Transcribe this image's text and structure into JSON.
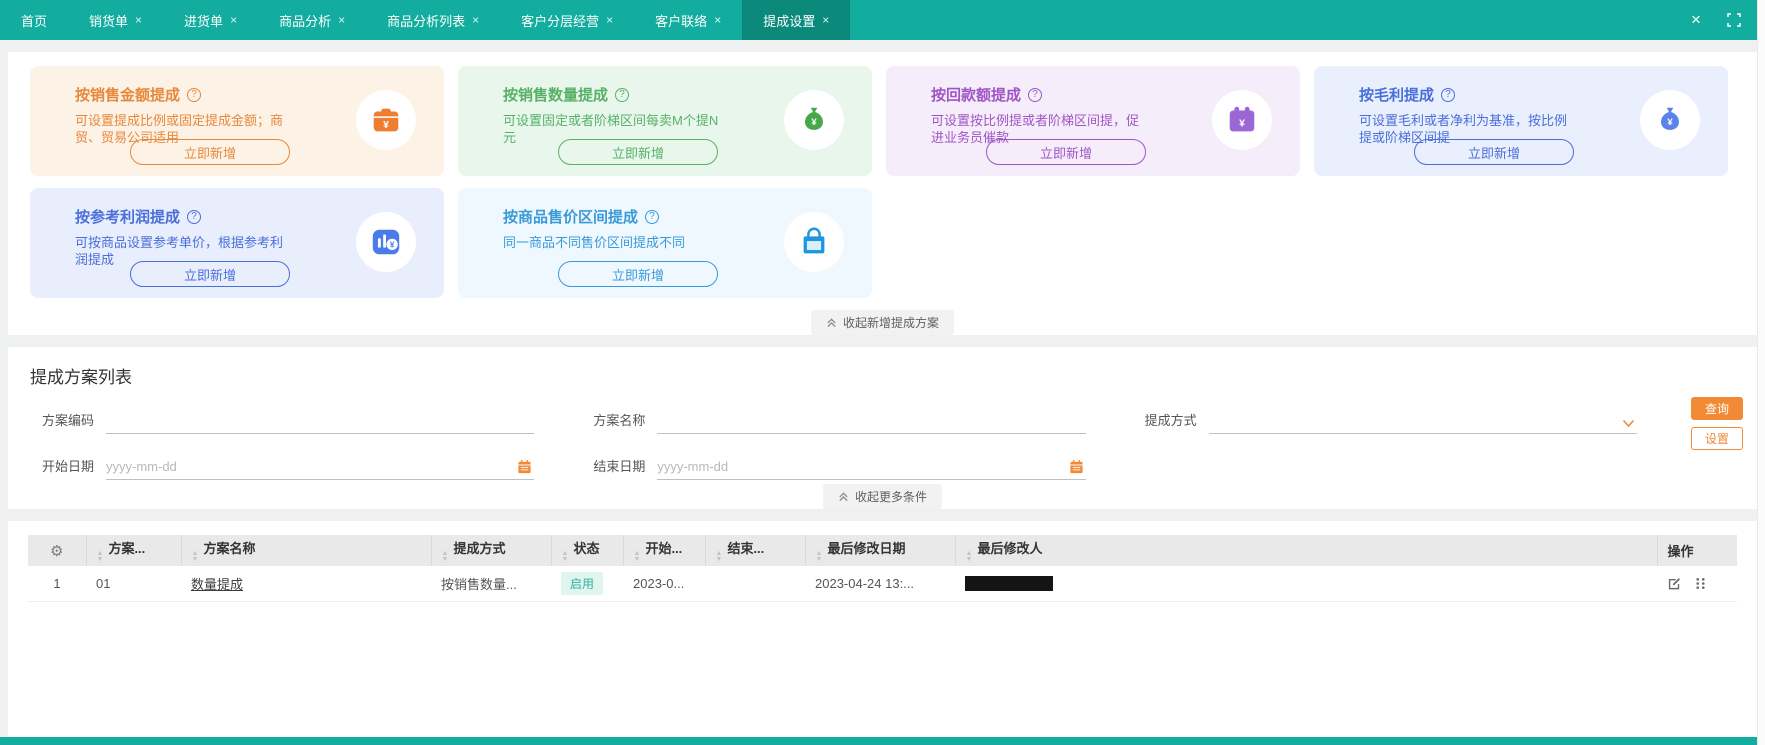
{
  "colors": {
    "teal": "#12ad9e",
    "teal_dark": "#0b8a7c",
    "orange": "#f28935",
    "card_orange_bg": "#fdf2e6",
    "card_orange_fg": "#e8883c",
    "card_orange_icon": "#ed7d2f",
    "card_green_bg": "#e8f6ec",
    "card_green_fg": "#58b167",
    "card_green_icon": "#46a84b",
    "card_purple_bg": "#f5eefa",
    "card_purple_fg": "#a055c6",
    "card_purple_icon": "#9a67d5",
    "card_blue_bg": "#e9effc",
    "card_blue_fg": "#4a6fdc",
    "card_blue_icon": "#5b82ea",
    "card_indigo_bg": "#e9eefc",
    "card_indigo_fg": "#4a6fdc",
    "card_indigo_icon": "#4a7be8",
    "card_cyan_bg": "#eef8fe",
    "card_cyan_fg": "#3b9ad8",
    "card_cyan_icon": "#1f97e0",
    "status_enabled_bg": "#e1f5ef",
    "status_enabled_fg": "#2fb49c"
  },
  "tab_bar": {
    "close_icon": "×",
    "tabs": [
      {
        "label": "首页",
        "closable": false,
        "active": false
      },
      {
        "label": "销货单",
        "closable": true,
        "active": false
      },
      {
        "label": "进货单",
        "closable": true,
        "active": false
      },
      {
        "label": "商品分析",
        "closable": true,
        "active": false
      },
      {
        "label": "商品分析列表",
        "closable": true,
        "active": false
      },
      {
        "label": "客户分层经营",
        "closable": true,
        "active": false
      },
      {
        "label": "客户联络",
        "closable": true,
        "active": false
      },
      {
        "label": "提成设置",
        "closable": true,
        "active": true
      }
    ]
  },
  "cards": [
    {
      "title": "按销售金额提成",
      "desc": "可设置提成比例或固定提成金额；商贸、贸易公司适用",
      "button": "立即新增",
      "icon": "purse-yen-icon"
    },
    {
      "title": "按销售数量提成",
      "desc": "可设置固定或者阶梯区间每卖M个提N元",
      "button": "立即新增",
      "icon": "moneybag-yen-icon"
    },
    {
      "title": "按回款额提成",
      "desc": "可设置按比例提或者阶梯区间提，促进业务员催款",
      "button": "立即新增",
      "icon": "calendar-yen-icon"
    },
    {
      "title": "按毛利提成",
      "desc": "可设置毛利或者净利为基准，按比例提或阶梯区间提",
      "button": "立即新增",
      "icon": "moneybag-yen-icon"
    },
    {
      "title": "按参考利润提成",
      "desc": "可按商品设置参考单价，根据参考利润提成",
      "button": "立即新增",
      "icon": "bar-chart-coin-icon"
    },
    {
      "title": "按商品售价区间提成",
      "desc": "同一商品不同售价区间提成不同",
      "button": "立即新增",
      "icon": "shopping-bag-icon"
    }
  ],
  "cards_collapse_label": "收起新增提成方案",
  "filter_section": {
    "title": "提成方案列表",
    "fields": {
      "code_label": "方案编码",
      "name_label": "方案名称",
      "method_label": "提成方式",
      "start_label": "开始日期",
      "end_label": "结束日期",
      "date_placeholder": "yyyy-mm-dd"
    },
    "buttons": {
      "search": "查询",
      "settings": "设置"
    },
    "collapse_label": "收起更多条件"
  },
  "table": {
    "headers": [
      "方案...",
      "方案名称",
      "提成方式",
      "状态",
      "开始...",
      "结束...",
      "最后修改日期",
      "最后修改人",
      "操作"
    ],
    "row": {
      "index": "1",
      "code": "01",
      "name": "数量提成",
      "method": "按销售数量...",
      "status": "启用",
      "start": "2023-0...",
      "end": "",
      "modified_date": "2023-04-24 13:...",
      "modified_by": ""
    }
  }
}
